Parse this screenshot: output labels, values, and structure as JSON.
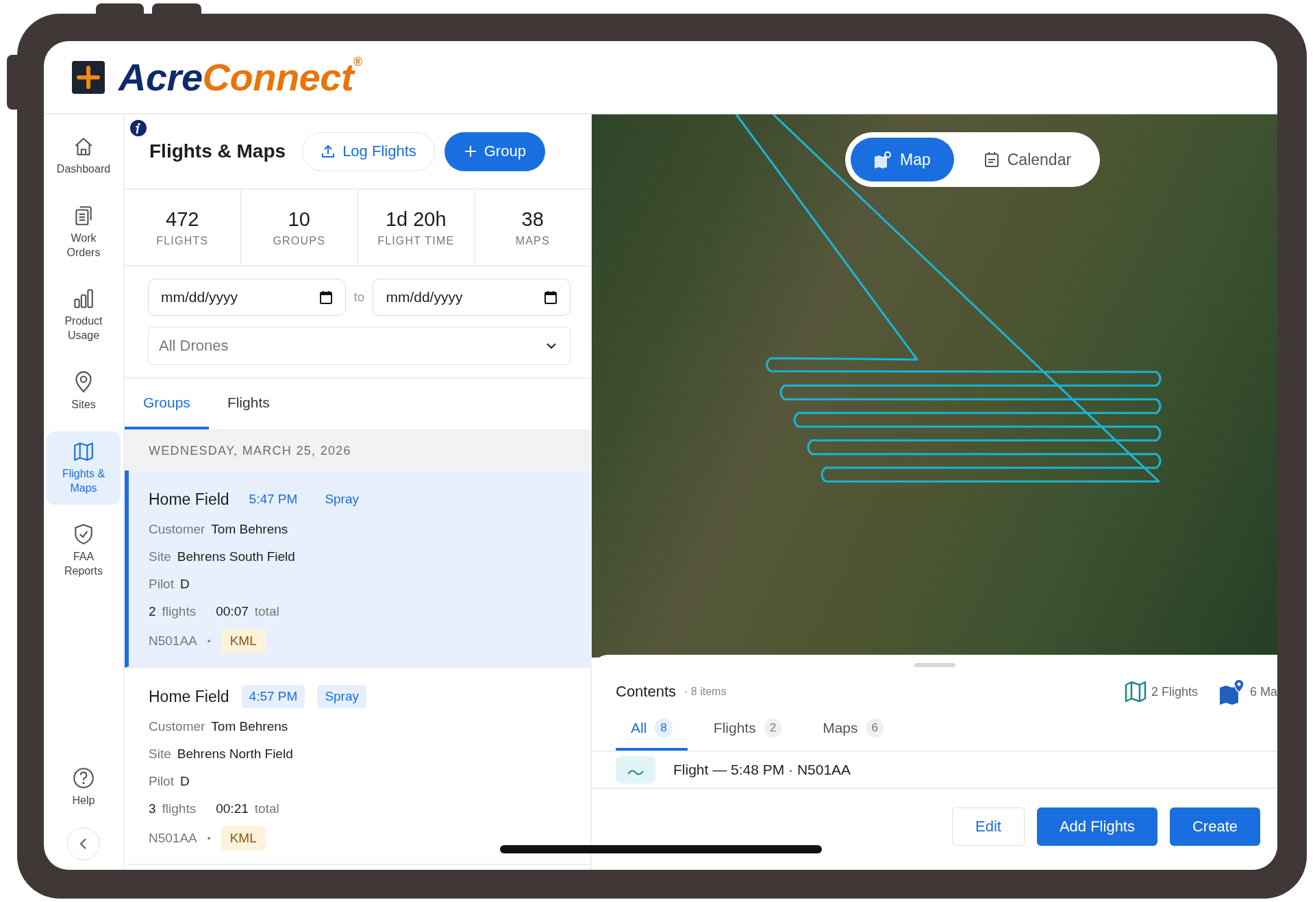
{
  "brand": {
    "part1": "Acre",
    "part2": "Connect",
    "registered": "®"
  },
  "sidebar": {
    "items": [
      {
        "label": "Dashboard",
        "kind": "home",
        "selected": false
      },
      {
        "label": "Work Orders",
        "kind": "clipboard",
        "selected": false
      },
      {
        "label": "Product Usage",
        "kind": "bars",
        "selected": false
      },
      {
        "label": "Sites",
        "kind": "pin",
        "selected": false
      },
      {
        "label": "Flights & Maps",
        "kind": "map",
        "selected": true
      },
      {
        "label": "FAA Reports",
        "kind": "shield",
        "selected": false
      }
    ],
    "help": {
      "label": "Help"
    }
  },
  "panel": {
    "title": "Flights & Maps",
    "actions": [
      {
        "label": "Log Flights",
        "kind": "outline"
      },
      {
        "label": "Group",
        "kind": "primary"
      }
    ],
    "stats": [
      {
        "value": "472",
        "label": "FLIGHTS"
      },
      {
        "value": "10",
        "label": "GROUPS"
      },
      {
        "value": "1d 20h",
        "label": "FLIGHT TIME"
      },
      {
        "value": "38",
        "label": "MAPS"
      }
    ],
    "filters": {
      "date_from": {
        "placeholder": "mm/dd/yyyy"
      },
      "to_label": "to",
      "date_to": {
        "placeholder": "mm/dd/yyyy"
      },
      "drone": {
        "value": "All Drones"
      }
    },
    "tabs": [
      {
        "label": "Groups",
        "selected": true
      },
      {
        "label": "Flights",
        "selected": false
      }
    ],
    "date_header": "WEDNESDAY, MARCH 25, 2026",
    "groups": [
      {
        "title": "Home Field",
        "time": "5:47 PM",
        "type": "Spray",
        "customer_label": "Customer",
        "customer": "Tom Behrens",
        "site_label": "Site",
        "site": "Behrens South Field",
        "pilot_label": "Pilot",
        "pilot": "D",
        "flights": "2",
        "flights_label": "flights",
        "total": "00:07",
        "total_label": "total",
        "tail": "N501AA",
        "separator": "•",
        "tag": "KML",
        "selected": true
      },
      {
        "title": "Home Field",
        "time": "4:57 PM",
        "type": "Spray",
        "customer_label": "Customer",
        "customer": "Tom Behrens",
        "site_label": "Site",
        "site": "Behrens North Field",
        "pilot_label": "Pilot",
        "pilot": "D",
        "flights": "3",
        "flights_label": "flights",
        "total": "00:21",
        "total_label": "total",
        "tail": "N501AA",
        "separator": "•",
        "tag": "KML",
        "selected": false
      }
    ]
  },
  "map": {
    "view_toggle": [
      {
        "label": "Map",
        "kind": "map",
        "selected": true
      },
      {
        "label": "Calendar",
        "kind": "calendar",
        "selected": false
      }
    ]
  },
  "contents": {
    "title": "Contents",
    "count": "· 8 items",
    "summary": [
      {
        "label": "2 Flights",
        "kind": "flights"
      },
      {
        "label": "6 Ma",
        "kind": "maps"
      }
    ],
    "tabs": [
      {
        "label": "All",
        "count": "8",
        "selected": true
      },
      {
        "label": "Flights",
        "count": "2",
        "selected": false
      },
      {
        "label": "Maps",
        "count": "6",
        "selected": false
      }
    ],
    "rows": [
      {
        "title": "Flight — 5:48 PM · N501AA"
      }
    ],
    "buttons": [
      {
        "label": "Edit",
        "kind": "outline"
      },
      {
        "label": "Add Flights",
        "kind": "primary"
      },
      {
        "label": "Create",
        "kind": "primary"
      }
    ]
  }
}
